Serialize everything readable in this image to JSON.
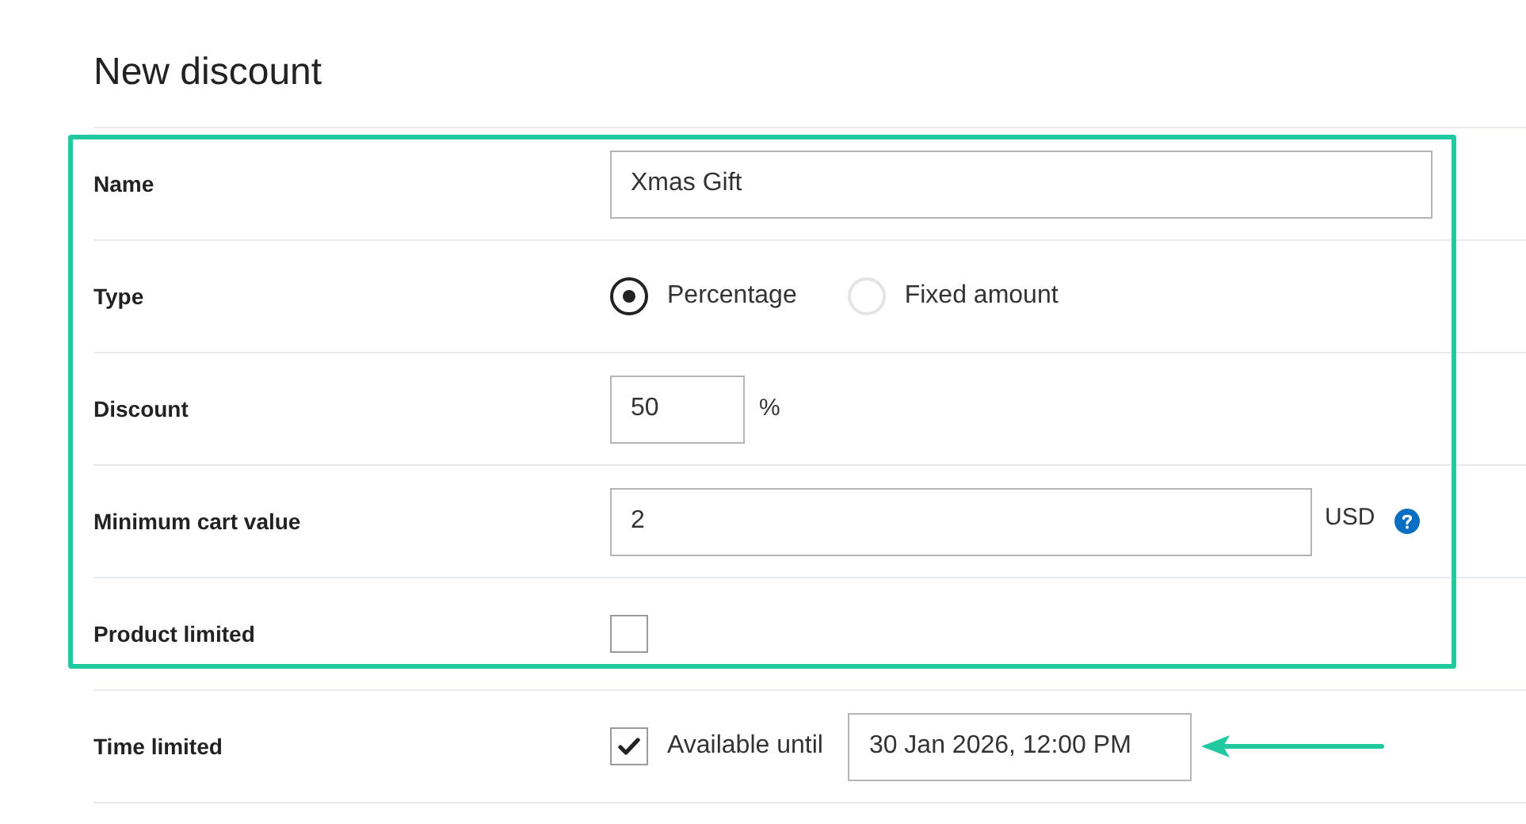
{
  "title": "New discount",
  "fields": [
    {
      "kind": "text",
      "label": "Name",
      "value": "Xmas Gift"
    },
    {
      "kind": "radio",
      "label": "Type",
      "options": [
        {
          "label": "Percentage",
          "selected": true
        },
        {
          "label": "Fixed amount",
          "selected": false
        }
      ]
    },
    {
      "kind": "number",
      "label": "Discount",
      "value": "50",
      "unit": "%"
    },
    {
      "kind": "amount",
      "label": "Minimum cart value",
      "value": "2",
      "unit": "USD"
    },
    {
      "kind": "checkbox",
      "label": "Product limited",
      "checked": false
    },
    {
      "kind": "datetime",
      "label": "Time limited",
      "checked": true,
      "option": "Available until",
      "value": "30 Jan 2026, 12:00 PM"
    }
  ]
}
